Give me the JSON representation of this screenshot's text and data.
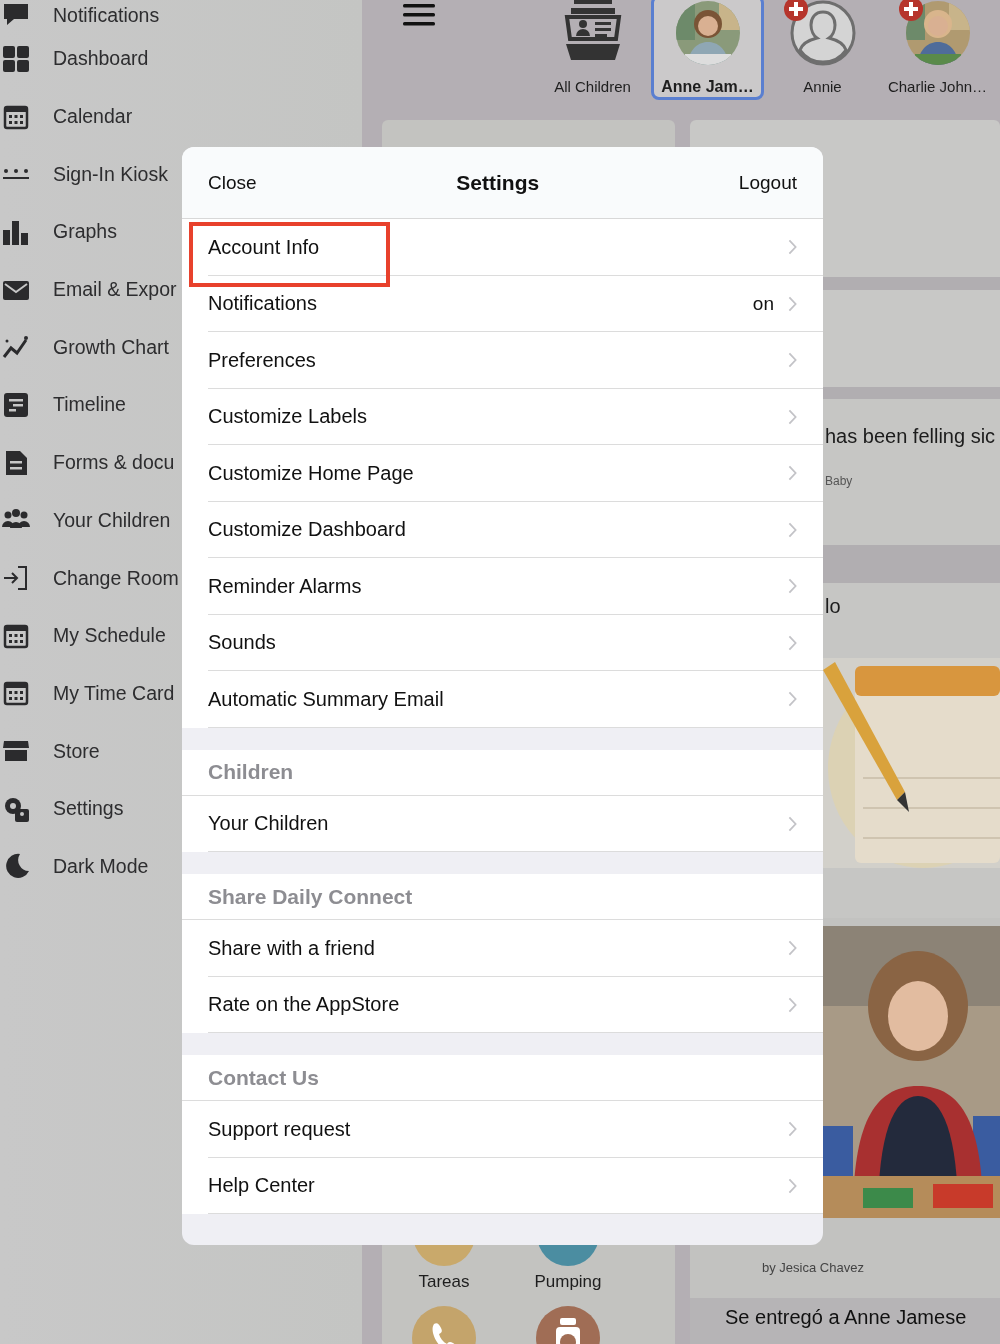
{
  "sidebar": {
    "items": [
      {
        "label": "Notifications"
      },
      {
        "label": "Dashboard"
      },
      {
        "label": "Calendar"
      },
      {
        "label": "Sign-In Kiosk"
      },
      {
        "label": "Graphs"
      },
      {
        "label": "Email & Expor"
      },
      {
        "label": "Growth Chart"
      },
      {
        "label": "Timeline"
      },
      {
        "label": "Forms & docu"
      },
      {
        "label": "Your Children"
      },
      {
        "label": "Change Room"
      },
      {
        "label": "My Schedule"
      },
      {
        "label": "My Time Card"
      },
      {
        "label": "Store"
      },
      {
        "label": "Settings"
      },
      {
        "label": "Dark Mode"
      }
    ]
  },
  "children_bar": [
    {
      "name": "All Children",
      "kind": "all",
      "selected": false,
      "alert": false
    },
    {
      "name": "Anne Jam…",
      "selected": true,
      "alert": false
    },
    {
      "name": "Annie",
      "kind": "placeholder",
      "selected": false,
      "alert": true
    },
    {
      "name": "Charlie John…",
      "selected": false,
      "alert": true
    }
  ],
  "feed": {
    "post_text": "has been felling sic",
    "post_tag": "Baby",
    "post2_text": "lo",
    "author": "by Jesica Chavez",
    "entry": "Se entregó a Anne Jamese"
  },
  "quick_actions": [
    {
      "label": "Tareas",
      "color": "#c9a96b"
    },
    {
      "label": "Pumping",
      "color": "#4b8da1"
    }
  ],
  "quick_actions_row2": [
    {
      "color": "#c4a46b"
    },
    {
      "color": "#a06d55"
    }
  ],
  "settings": {
    "close": "Close",
    "title": "Settings",
    "logout": "Logout",
    "items": [
      {
        "kind": "row",
        "label": "Account Info",
        "highlighted": true
      },
      {
        "kind": "row",
        "label": "Notifications",
        "value": "on",
        "highlighted": false
      },
      {
        "kind": "row",
        "label": "Preferences",
        "highlighted": false
      },
      {
        "kind": "row",
        "label": "Customize Labels",
        "highlighted": false
      },
      {
        "kind": "row",
        "label": "Customize Home Page",
        "highlighted": false
      },
      {
        "kind": "row",
        "label": "Customize Dashboard",
        "highlighted": false
      },
      {
        "kind": "row",
        "label": "Reminder Alarms",
        "highlighted": false
      },
      {
        "kind": "row",
        "label": "Sounds",
        "highlighted": false
      },
      {
        "kind": "row",
        "label": "Automatic Summary Email",
        "highlighted": false
      },
      {
        "kind": "header",
        "label": "Children"
      },
      {
        "kind": "row",
        "label": "Your Children",
        "highlighted": false
      },
      {
        "kind": "header",
        "label": "Share Daily Connect"
      },
      {
        "kind": "row",
        "label": "Share with a friend",
        "highlighted": false
      },
      {
        "kind": "row",
        "label": "Rate on the AppStore",
        "highlighted": false
      },
      {
        "kind": "header",
        "label": "Contact Us"
      },
      {
        "kind": "row",
        "label": "Support request",
        "highlighted": false
      },
      {
        "kind": "row",
        "label": "Help Center",
        "highlighted": false
      }
    ]
  }
}
